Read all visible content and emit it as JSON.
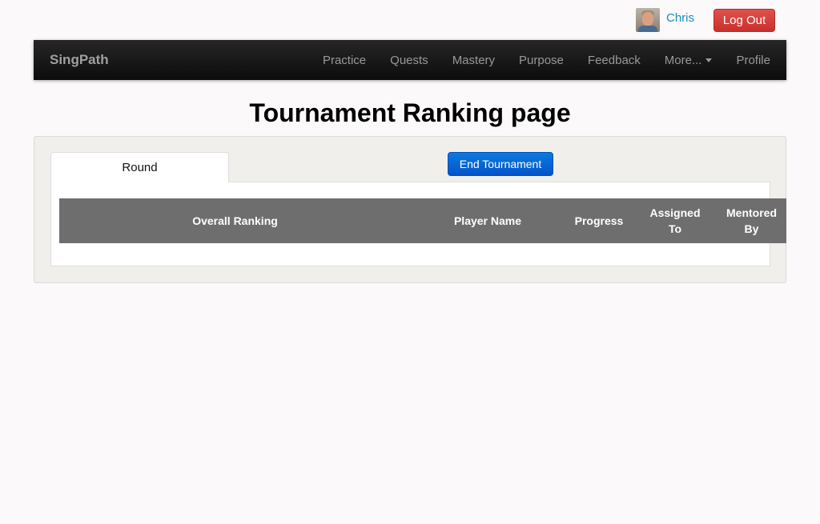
{
  "user": {
    "name": "Chris",
    "logout_label": "Log Out"
  },
  "navbar": {
    "brand": "SingPath",
    "items": [
      {
        "label": "Practice"
      },
      {
        "label": "Quests"
      },
      {
        "label": "Mastery"
      },
      {
        "label": "Purpose"
      },
      {
        "label": "Feedback"
      },
      {
        "label": "More..."
      },
      {
        "label": "Profile"
      }
    ]
  },
  "page": {
    "title": "Tournament Ranking page"
  },
  "panel": {
    "tab_label": "Round",
    "end_button_label": "End Tournament",
    "table": {
      "headers": [
        {
          "line1": "Overall Ranking",
          "line2": ""
        },
        {
          "line1": "Player Name",
          "line2": ""
        },
        {
          "line1": "Progress",
          "line2": ""
        },
        {
          "line1": "Assigned",
          "line2": "To"
        },
        {
          "line1": "Mentored",
          "line2": "By"
        }
      ],
      "rows": []
    }
  },
  "colors": {
    "background": "#fbf9f9",
    "navbar": "#1a1a1a",
    "link": "#1a8bc3",
    "danger": "#d9443f",
    "primary": "#0665d6",
    "table_header": "#6e6e6e"
  }
}
